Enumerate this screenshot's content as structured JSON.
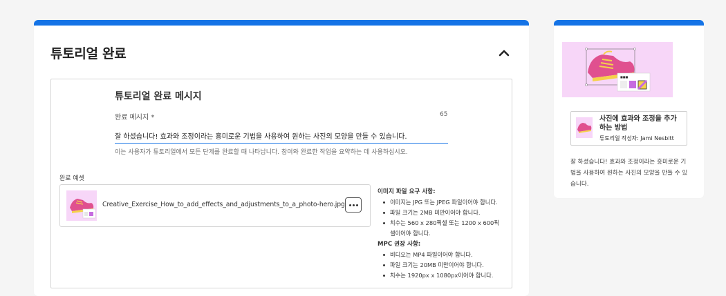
{
  "main": {
    "title": "튜토리얼 완료",
    "inner_heading": "튜토리얼 완료 메시지",
    "field_label": "완료 메시지 *",
    "char_count": "65",
    "message_value": "잘 하셨습니다! 효과와 조정이라는 흥미로운 기법을 사용하여 원하는 사진의 모양을 만들 수 있습니다.",
    "help_text": "이는 사용자가 튜토리얼에서 모든 단계를 완료할 때 나타납니다. 참여와 완료한 작업을 요약하는 데 사용하십시오.",
    "example_label": "완료 예셋",
    "file_name": "Creative_Exercise_How_to_add_effects_and_adjustments_to_a_photo-hero.jpg",
    "image_req_title": "이미지 파일 요구 사항:",
    "image_req": [
      "이미지는 JPG 또는 JPEG 파일이어야 합니다.",
      "파일 크기는 2MB 미만이어야 합니다.",
      "치수는 560 x 280픽셀 또는 1200 x 600픽셀이어야 합니다."
    ],
    "mpc_title": "MPC 권장 사항:",
    "mpc_req": [
      "비디오는 MP4 파일이어야 합니다.",
      "파일 크기는 20MB 미만이어야 합니다.",
      "치수는 1920px x 1080px이어야 합니다."
    ]
  },
  "side": {
    "tutorial_title": "사진에 효과와 조정을 추가하는 방법",
    "tutorial_author": "튜토리얼 작성자: Jami Nesbitt",
    "message": "잘 하셨습니다! 효과와 조정이라는 흥미로운 기법을 사용하여 원하는 사진의 모양을 만들 수 있습니다."
  },
  "colors": {
    "accent": "#1473e6",
    "preview_bg": "#f7d6f8",
    "shoe": "#e0508f"
  },
  "icons": [
    "chevron-up-icon",
    "more-icon",
    "shoe-image",
    "shoe-thumbnail"
  ]
}
